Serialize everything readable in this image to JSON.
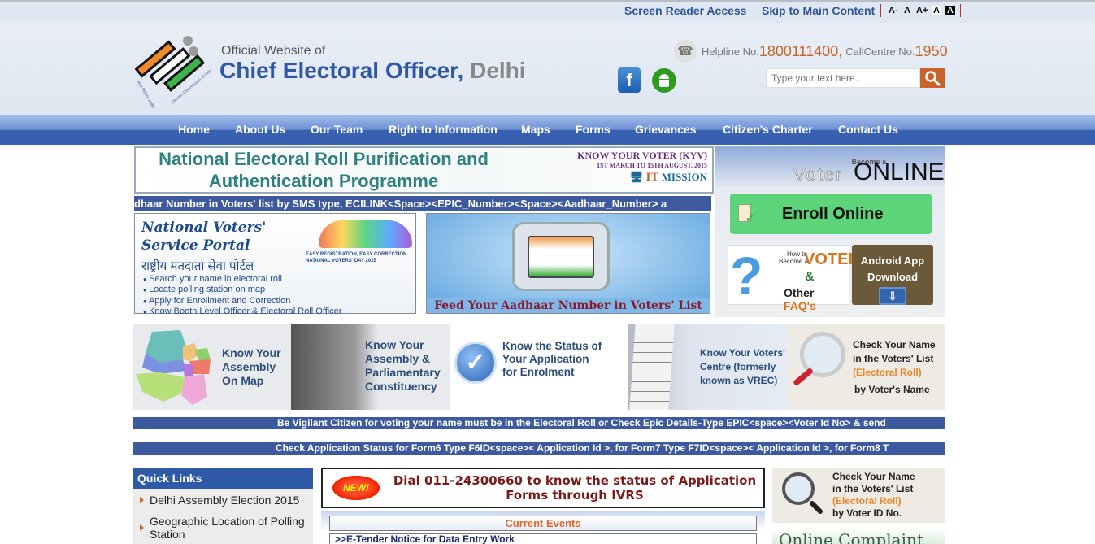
{
  "topbar": {
    "screen_reader": "Screen Reader Access",
    "skip_main": "Skip to Main Content",
    "font_sizes": [
      "A-",
      "A",
      "A+"
    ],
    "contrast": [
      "A",
      "A"
    ]
  },
  "header": {
    "subtitle": "Official Website of",
    "title": "Chief Electoral Officer,",
    "city": "Delhi",
    "helpline_label": "Helpline No.",
    "helpline_number": "1800111400,",
    "callcentre_label": "CallCentre No.",
    "callcentre_number": "1950",
    "search_placeholder": "Type your text here..",
    "facebook_letter": "f",
    "icons": {
      "phone": "telephone-icon",
      "facebook": "facebook-icon",
      "android": "android-icon",
      "search": "search-icon"
    }
  },
  "nav": {
    "items": [
      {
        "label": "Home"
      },
      {
        "label": "About Us"
      },
      {
        "label": "Our Team"
      },
      {
        "label": "Right to Information"
      },
      {
        "label": "Maps"
      },
      {
        "label": "Forms"
      },
      {
        "label": "Grievances"
      },
      {
        "label": "Citizen's Charter"
      },
      {
        "label": "Contact Us"
      }
    ]
  },
  "banners": {
    "nerp": {
      "title": "National Electoral Roll Purification and Authentication Programme",
      "kyv": "KNOW YOUR VOTER (KYV)",
      "dates": "1ST MARCH TO 15TH AUGUST, 2015",
      "it": "IT",
      "mission": "MISSION"
    },
    "marquee_aadhaar": "dhaar Number in Voters' list by SMS type, ECILINK<Space><EPIC_Number><Space><Aadhaar_Number> a",
    "nvsp": {
      "title_line1": "National Voters'",
      "title_line2": "Service Portal",
      "hindi": "राष्ट्रीय मतदाता सेवा पोर्टल",
      "tagline1": "EASY REGISTRATION, EASY CORRECTION",
      "tagline2": "NATIONAL VOTERS' DAY 2015",
      "bullets": [
        "Search your name in electoral roll",
        "Locate polling station on map",
        "Apply for Enrollment and Correction",
        "Know Booth Level Officer & Electoral Roll Officer"
      ]
    },
    "aadhaar_caption": "Feed Your Aadhaar Number in Voters' List"
  },
  "voter_panel": {
    "become": "Become a",
    "voter": "Voter",
    "online": "ONLINE",
    "enroll_label": "Enroll Online",
    "faq_how": "How to",
    "faq_become": "Become a",
    "faq_voter": "VOTER",
    "faq_amp": "&",
    "faq_other": "Other",
    "faq_faqs": "FAQ's",
    "android_line1": "Android App",
    "android_line2": "Download",
    "download_arrow": "⇩"
  },
  "tiles": {
    "map": [
      "Know Your",
      "Assembly",
      "On Map"
    ],
    "constituency": [
      "Know Your",
      "Assembly &",
      "Parliamentary",
      "Constituency"
    ],
    "status": [
      "Know the Status of",
      "Your Application",
      "for Enrolment"
    ],
    "vrec": [
      "Know Your Voters'",
      "Centre (formerly",
      "known as VREC)"
    ],
    "name_search": {
      "l1": "Check Your Name",
      "l2": "in the Voters' List",
      "l3": "(Electoral Roll)",
      "l4": "by Voter's Name"
    },
    "check_mark": "✓"
  },
  "marquees": {
    "vigilant": "Be Vigilant Citizen for voting your name must be in the Electoral Roll or Check Epic Details-Type EPIC<space><Voter Id No> & send",
    "status": "Check Application Status for Form6 Type F6ID<space>< Application Id >, for Form7 Type F7ID<space>< Application Id >, for Form8 T"
  },
  "quick_links": {
    "title": "Quick Links",
    "items": [
      {
        "label": "Delhi Assembly Election 2015"
      },
      {
        "label": "Geographic Location of Polling Station"
      }
    ]
  },
  "ivrs": {
    "new_badge": "NEW!",
    "text": "Dial 011-24300660 to know the status of Application Forms through IVRS"
  },
  "current_events": {
    "title": "Current Events",
    "items": [
      ">>E-Tender Notice for Data Entry Work"
    ]
  },
  "voter_id_search": {
    "l1": "Check Your Name",
    "l2": "in the Voters' List",
    "l3": "(Electoral Roll)",
    "l4": "by Voter ID No."
  },
  "online_complaint": "Online Complaint"
}
